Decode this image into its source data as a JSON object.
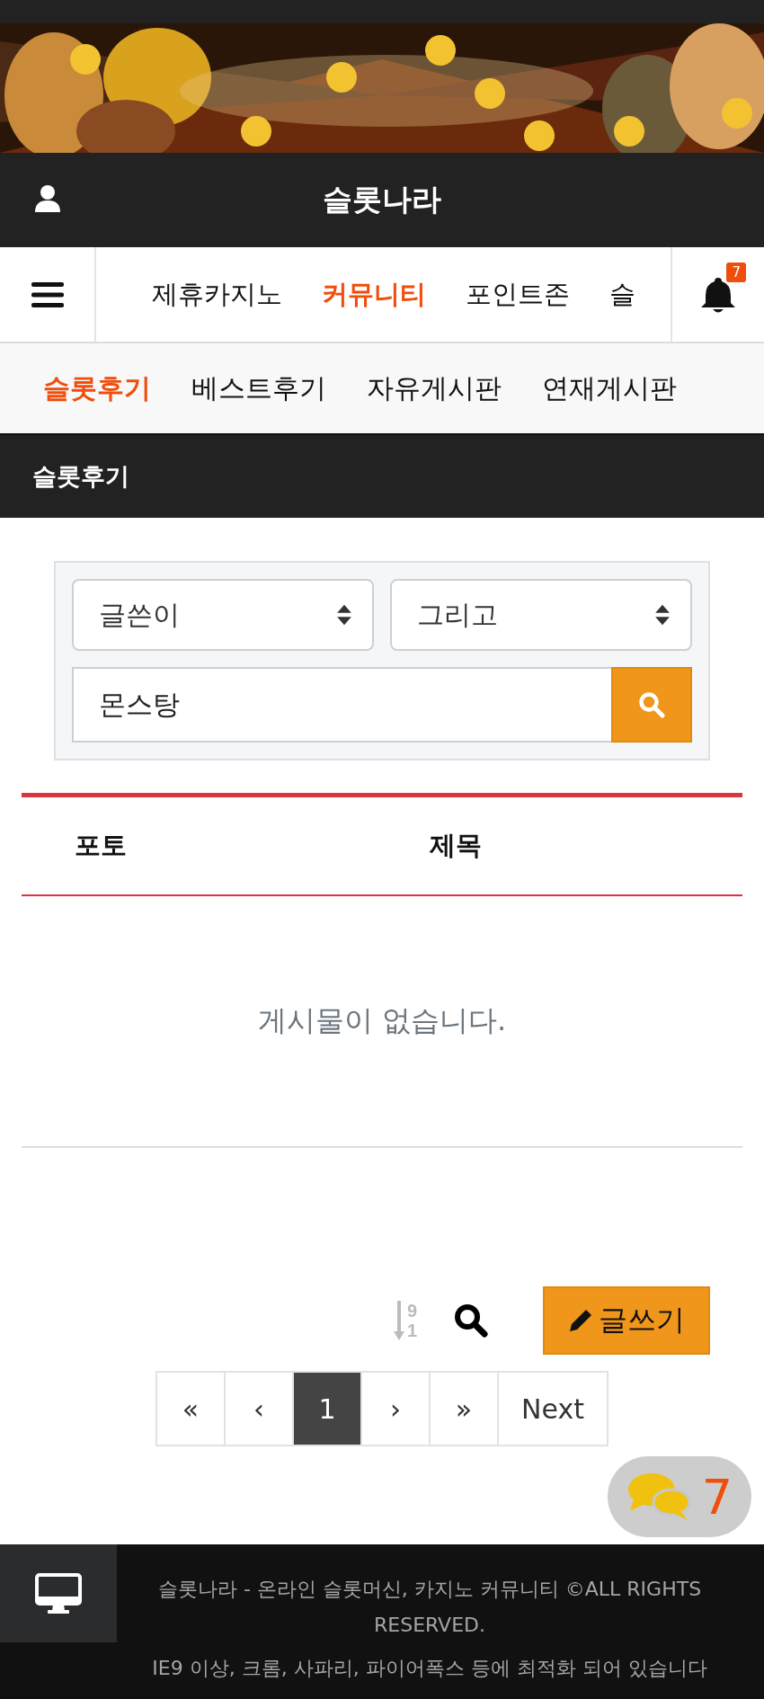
{
  "header": {
    "title": "슬롯나라"
  },
  "nav": {
    "items": [
      {
        "label": "제휴카지노",
        "selected": false
      },
      {
        "label": "커뮤니티",
        "selected": true
      },
      {
        "label": "포인트존",
        "selected": false
      },
      {
        "label": "슬",
        "selected": false
      }
    ],
    "notification_count": "7"
  },
  "subnav": [
    {
      "label": "슬롯후기",
      "selected": true
    },
    {
      "label": "베스트후기",
      "selected": false
    },
    {
      "label": "자유게시판",
      "selected": false
    },
    {
      "label": "연재게시판",
      "selected": false
    }
  ],
  "section_title": "슬롯후기",
  "search": {
    "field_select": "글쓴이",
    "operator_select": "그리고",
    "query": "몬스탕"
  },
  "table": {
    "columns": [
      "포토",
      "제목"
    ],
    "empty_message": "게시물이 없습니다."
  },
  "toolbar": {
    "sort_digits": [
      "9",
      "1"
    ],
    "write_button": "글쓰기"
  },
  "pagination": [
    {
      "label": "«",
      "selected": false
    },
    {
      "label": "‹",
      "selected": false
    },
    {
      "label": "1",
      "selected": true
    },
    {
      "label": "›",
      "selected": false
    },
    {
      "label": "»",
      "selected": false
    },
    {
      "label": "Next",
      "selected": false
    }
  ],
  "footer": {
    "lines": [
      "슬롯나라 - 온라인 슬롯머신, 카지노 커뮤니티 ©ALL RIGHTS RESERVED.",
      "IE9 이상, 크롬, 사파리, 파이어폭스 등에 최적화 되어 있습니다"
    ]
  },
  "chat_widget": {
    "count": "7"
  }
}
